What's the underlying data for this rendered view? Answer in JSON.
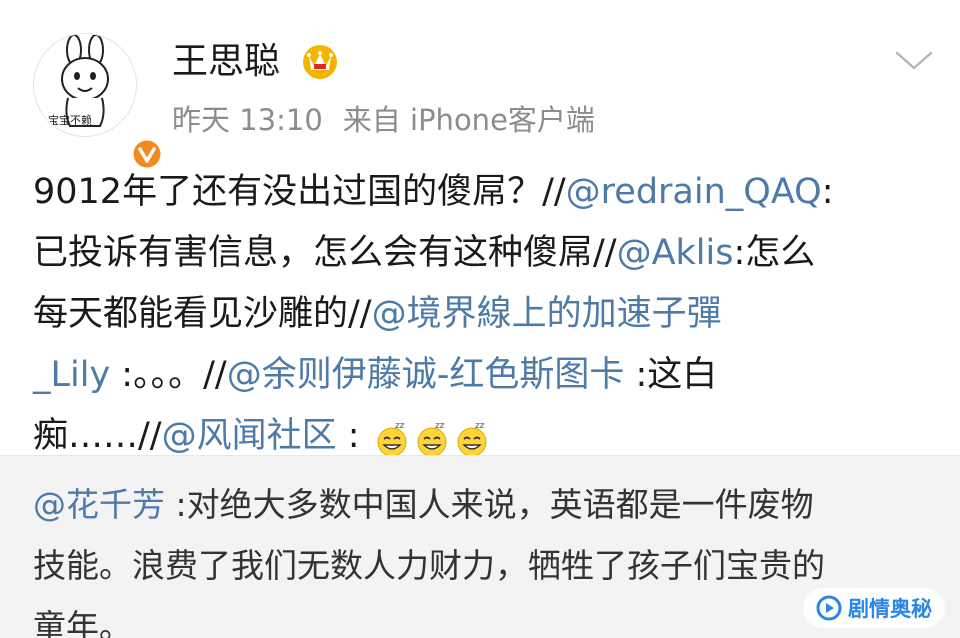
{
  "header": {
    "avatar_caption": "宝宝不赖",
    "username": "王思聪",
    "time": "昨天 13:10",
    "source": "来自 iPhone客户端"
  },
  "post": {
    "lines": [
      [
        {
          "t": "9012年了还有没出过国的傻屌？//",
          "m": false
        },
        {
          "t": "@redrain_QAQ",
          "m": true
        },
        {
          "t": ":",
          "m": false
        }
      ],
      [
        {
          "t": "已投诉有害信息，怎么会有这种傻屌//",
          "m": false
        },
        {
          "t": "@Aklis",
          "m": true
        },
        {
          "t": ":怎么",
          "m": false
        }
      ],
      [
        {
          "t": "每天都能看见沙雕的//",
          "m": false
        },
        {
          "t": "@境界線上的加速子彈",
          "m": true
        }
      ],
      [
        {
          "t": "_Lily",
          "m": true
        },
        {
          "t": " :。。。//",
          "m": false
        },
        {
          "t": "@余则伊藤诚-红色斯图卡",
          "m": true
        },
        {
          "t": " :这白",
          "m": false
        }
      ],
      [
        {
          "t": "痴……//",
          "m": false
        },
        {
          "t": "@风闻社区",
          "m": true
        },
        {
          "t": " : ",
          "m": false
        }
      ]
    ],
    "emoji_icons": [
      "sleepy-grin-emoji-icon",
      "sleepy-grin-emoji-icon",
      "sleepy-grin-emoji-icon"
    ]
  },
  "retweet": {
    "lines": [
      [
        {
          "t": "@花千芳",
          "m": true
        },
        {
          "t": " :对绝大多数中国人来说，英语都是一件废物",
          "m": false
        }
      ],
      [
        {
          "t": "技能。浪费了我们无数人力财力，牺牲了孩子们宝贵的",
          "m": false
        }
      ],
      [
        {
          "t": "童年。",
          "m": false
        }
      ]
    ]
  },
  "watermark": {
    "text": "剧情奥秘"
  },
  "colors": {
    "mention": "#4e7aa8",
    "text": "#1a1a1a",
    "meta": "#8c8c8c",
    "retweet_bg": "#f3f3f3",
    "verified_badge": "#f28a1e",
    "vip_crown": "#f5b400",
    "watermark_text": "#2a86e8"
  },
  "icons": {
    "verified": "verified-badge-icon",
    "vip": "vip-crown-icon",
    "expand": "chevron-down-icon",
    "watermark_logo": "play-logo-icon"
  }
}
